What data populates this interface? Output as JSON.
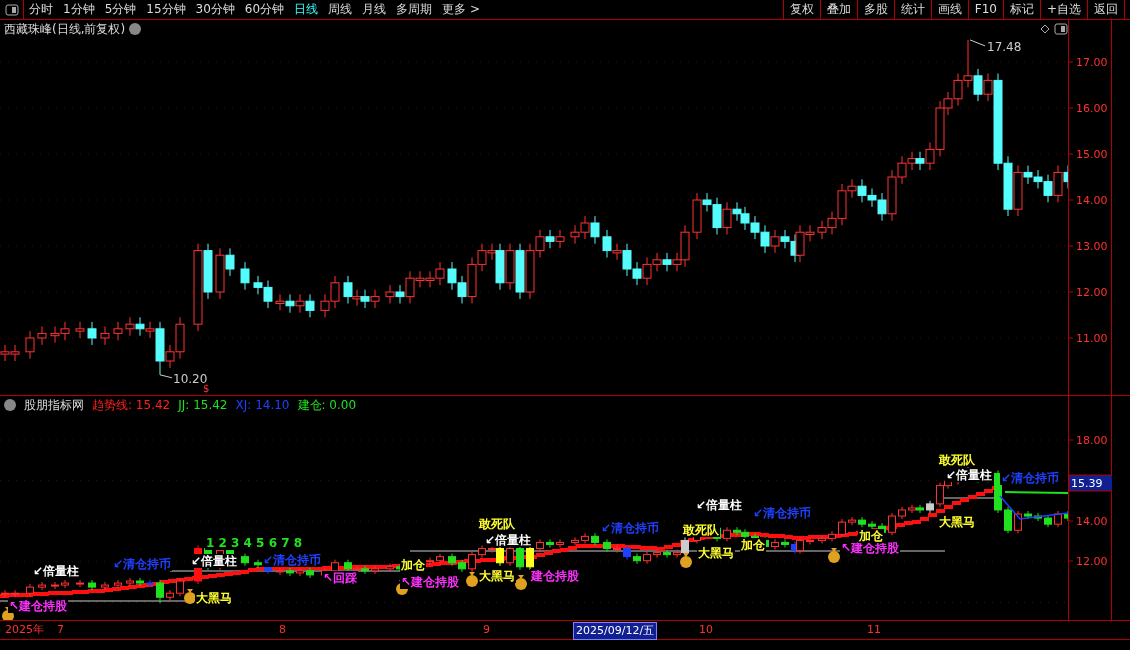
{
  "toolbar": {
    "tabs": [
      {
        "label": "分时",
        "selected": false
      },
      {
        "label": "1分钟",
        "selected": false
      },
      {
        "label": "5分钟",
        "selected": false
      },
      {
        "label": "15分钟",
        "selected": false
      },
      {
        "label": "30分钟",
        "selected": false
      },
      {
        "label": "60分钟",
        "selected": false
      },
      {
        "label": "日线",
        "selected": true
      },
      {
        "label": "周线",
        "selected": false
      },
      {
        "label": "月线",
        "selected": false
      },
      {
        "label": "多周期",
        "selected": false
      },
      {
        "label": "更多 >",
        "selected": false
      }
    ],
    "buttons": [
      "复权",
      "叠加",
      "多股",
      "统计",
      "画线",
      "F10",
      "标记",
      "+自选",
      "返回"
    ]
  },
  "main_chart": {
    "title": "西藏珠峰(日线,前复权)",
    "high_label": "17.48",
    "low_label": "10.20",
    "marker": "$",
    "axis_labels": [
      "17.00",
      "16.00",
      "15.00",
      "14.00",
      "13.00",
      "12.00",
      "11.00"
    ]
  },
  "indicator": {
    "name": "股朋指标网",
    "values": [
      {
        "text": "趋势线: 15.42",
        "color": "#ff2020"
      },
      {
        "text": "JJ: 15.42",
        "color": "#20e020"
      },
      {
        "text": "XJ: 14.10",
        "color": "#2040ff"
      },
      {
        "text": "建仓: 0.00",
        "color": "#20e020"
      }
    ],
    "signals": [
      {
        "text": "↙倍量柱",
        "color": "#ffffff"
      },
      {
        "text": "↖建仓持股",
        "color": "#ff30ff"
      },
      {
        "text": "↙清仓持币",
        "color": "#2040ff"
      },
      {
        "text": "1 2 3 4 5 6 7 8",
        "color": "#20e020"
      },
      {
        "text": "↙倍量柱",
        "color": "#ffffff"
      },
      {
        "text": "大黑马",
        "color": "#ffff30"
      },
      {
        "text": "↙清仓持币",
        "color": "#2040ff"
      },
      {
        "text": "↖回踩",
        "color": "#ff30ff"
      },
      {
        "text": "加仓",
        "color": "#ffff30"
      },
      {
        "text": "↖建仓持股",
        "color": "#ff30ff"
      },
      {
        "text": "敢死队",
        "color": "#ffff30"
      },
      {
        "text": "↙倍量柱",
        "color": "#ffffff"
      },
      {
        "text": "大黑马",
        "color": "#ffff30"
      },
      {
        "text": "建仓持股",
        "color": "#ff30ff"
      },
      {
        "text": "↙清仓持币",
        "color": "#2040ff"
      },
      {
        "text": "↙倍量柱",
        "color": "#ffffff"
      },
      {
        "text": "敢死队",
        "color": "#ffff30"
      },
      {
        "text": "大黑马",
        "color": "#ffff30"
      },
      {
        "text": "加仓",
        "color": "#ffff30"
      },
      {
        "text": "↙清仓持币",
        "color": "#2040ff"
      },
      {
        "text": "↖建仓持股",
        "color": "#ff30ff"
      },
      {
        "text": "加仓",
        "color": "#ffff30"
      },
      {
        "text": "敢死队",
        "color": "#ffff30"
      },
      {
        "text": "↙倍量柱",
        "color": "#ffffff"
      },
      {
        "text": "大黑马",
        "color": "#ffff30"
      },
      {
        "text": "↙清仓持币",
        "color": "#2040ff"
      }
    ],
    "axis_labels": [
      "18.00",
      "14.00",
      "12.00"
    ],
    "current_value": "15.39"
  },
  "date_axis": {
    "labels": [
      {
        "text": "2025年",
        "selected": false
      },
      {
        "text": "7",
        "selected": false
      },
      {
        "text": "8",
        "selected": false
      },
      {
        "text": "9",
        "selected": false
      },
      {
        "text": "2025/09/12/五",
        "selected": true
      },
      {
        "text": "10",
        "selected": false
      },
      {
        "text": "11",
        "selected": false
      }
    ]
  }
}
